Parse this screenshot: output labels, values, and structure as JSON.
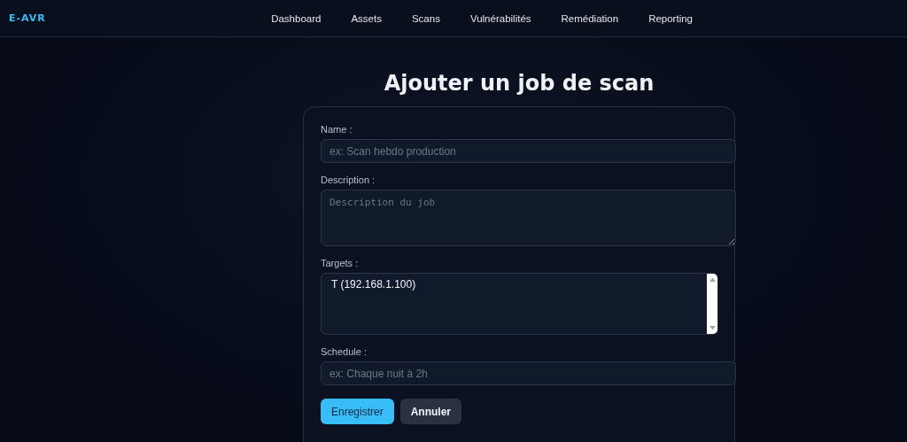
{
  "brand": "E-AVR",
  "nav": [
    {
      "label": "Dashboard"
    },
    {
      "label": "Assets"
    },
    {
      "label": "Scans"
    },
    {
      "label": "Vulnérabilités"
    },
    {
      "label": "Remédiation"
    },
    {
      "label": "Reporting"
    }
  ],
  "title": "Ajouter un job de scan",
  "fields": [
    {
      "kind": "input",
      "label": "Name :",
      "placeholder": "ex: Scan hebdo production"
    },
    {
      "kind": "textarea",
      "label": "Description :",
      "placeholder": "Description du job"
    },
    {
      "kind": "list",
      "label": "Targets :",
      "options": [
        {
          "label": "T (192.168.1.100)",
          "selected": false
        }
      ]
    },
    {
      "kind": "input",
      "label": "Schedule :",
      "placeholder": "ex: Chaque nuit à 2h"
    }
  ],
  "buttons": [
    {
      "label": "Enregistrer",
      "kind": "primary"
    },
    {
      "label": "Annuler",
      "kind": "secondary"
    }
  ]
}
